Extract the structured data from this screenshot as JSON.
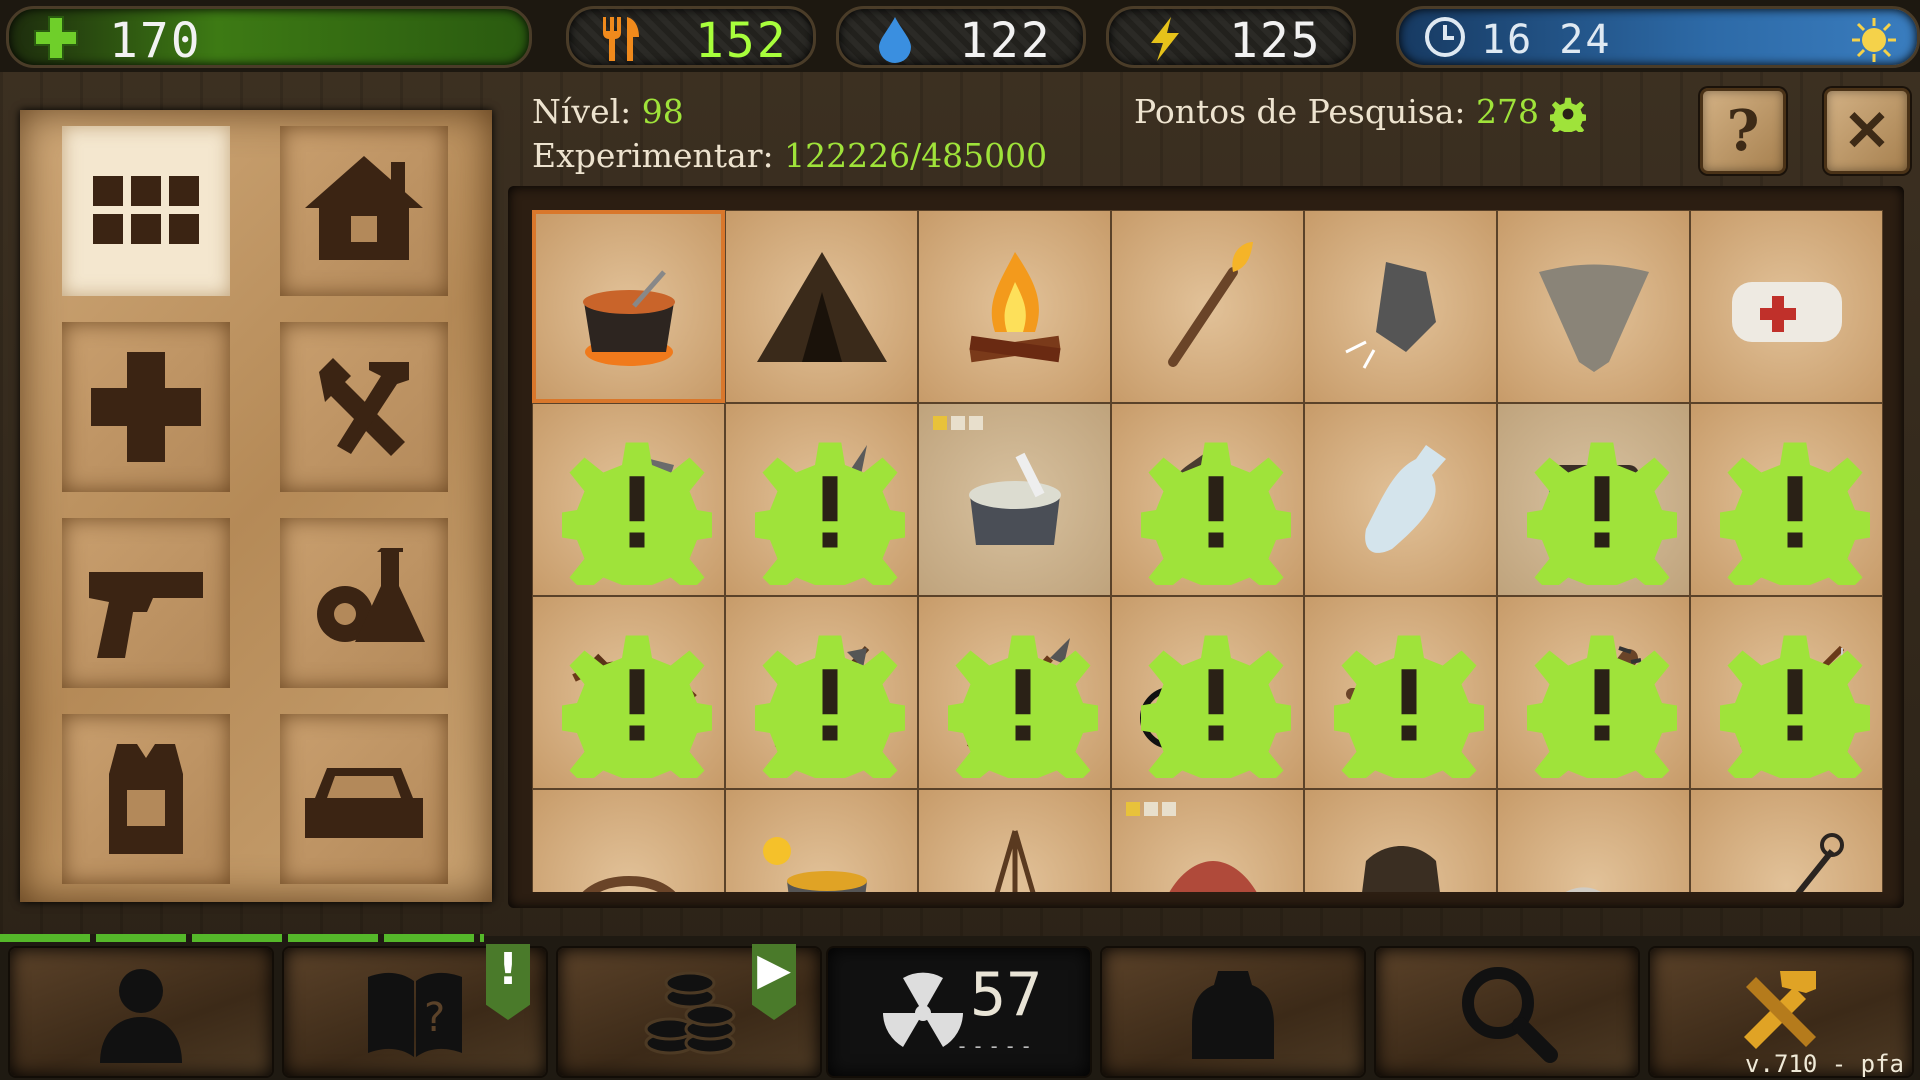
{
  "stats": {
    "health": "170",
    "food": "152",
    "water": "122",
    "energy": "125",
    "time": "16 24"
  },
  "header": {
    "level_label": "Nível:",
    "level_value": "98",
    "xp_label": "Experimentar:",
    "xp_value": "122226/485000",
    "research_label": "Pontos de Pesquisa:",
    "research_value": "278",
    "help_label": "?",
    "close_label": "✕"
  },
  "categories": [
    {
      "name": "all",
      "icon": "grid-icon",
      "active": true
    },
    {
      "name": "shelter",
      "icon": "house-icon"
    },
    {
      "name": "medical",
      "icon": "medical-cross-icon"
    },
    {
      "name": "tools",
      "icon": "wrench-hammer-icon"
    },
    {
      "name": "weapons",
      "icon": "pistol-icon"
    },
    {
      "name": "research",
      "icon": "gear-flask-icon"
    },
    {
      "name": "armor",
      "icon": "vest-icon"
    },
    {
      "name": "vehicles",
      "icon": "car-icon"
    }
  ],
  "items": [
    {
      "icon": "cooking-pot-icon",
      "selected": true
    },
    {
      "icon": "hut-icon"
    },
    {
      "icon": "campfire-icon"
    },
    {
      "icon": "torch-icon"
    },
    {
      "icon": "flint-stone-icon"
    },
    {
      "icon": "bandana-icon"
    },
    {
      "icon": "bandage-icon"
    },
    {
      "icon": "stone-axe-icon",
      "research": true
    },
    {
      "icon": "stone-knife-icon",
      "research": true
    },
    {
      "icon": "bone-soup-icon",
      "dim": true,
      "pips": 1
    },
    {
      "icon": "sack-icon",
      "research": true
    },
    {
      "icon": "bottle-icon"
    },
    {
      "icon": "water-filter-icon",
      "research": true,
      "dim": true
    },
    {
      "icon": "charcoal-icon",
      "research": true
    },
    {
      "icon": "crossbow-icon",
      "research": true
    },
    {
      "icon": "arrow-icon",
      "research": true
    },
    {
      "icon": "spear-icon",
      "research": true
    },
    {
      "icon": "bicycle-icon",
      "research": true
    },
    {
      "icon": "raft-icon",
      "research": true
    },
    {
      "icon": "spiked-club-icon",
      "research": true
    },
    {
      "icon": "fishing-rod-icon",
      "research": true
    },
    {
      "icon": "rope-icon"
    },
    {
      "icon": "radioactive-stew-icon"
    },
    {
      "icon": "tripod-icon"
    },
    {
      "icon": "meat-icon",
      "pips": 1
    },
    {
      "icon": "cloak-icon"
    },
    {
      "icon": "cloth-icon"
    },
    {
      "icon": "hook-icon"
    }
  ],
  "bottom": {
    "radiation": "57",
    "radiation_dashes": "-----",
    "version": "v.710 - pfa",
    "quest_flag": "!",
    "shop_flag": "▶"
  },
  "colors": {
    "accent_green": "#9fe33a",
    "health_green": "#3d7a14",
    "time_blue": "#2d6aa7",
    "selected_border": "#d9772b"
  }
}
